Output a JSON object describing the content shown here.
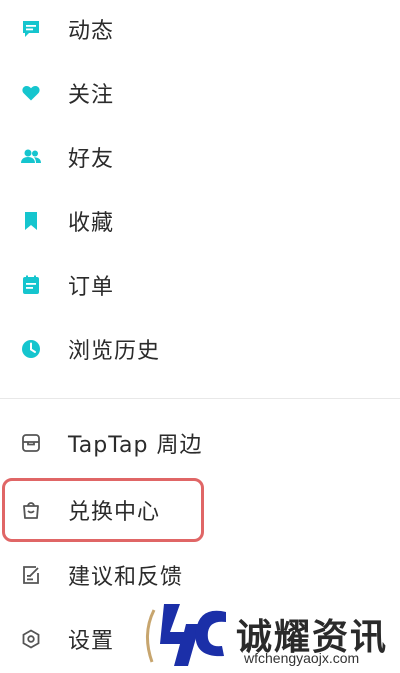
{
  "menu": {
    "items": [
      {
        "label": "动态",
        "icon": "chat-bubble-icon"
      },
      {
        "label": "关注",
        "icon": "heart-icon"
      },
      {
        "label": "好友",
        "icon": "friends-icon"
      },
      {
        "label": "收藏",
        "icon": "bookmark-icon"
      },
      {
        "label": "订单",
        "icon": "order-icon"
      },
      {
        "label": "浏览历史",
        "icon": "clock-icon"
      }
    ],
    "secondary": [
      {
        "label": "TapTap 周边",
        "icon": "merch-icon"
      },
      {
        "label": "兑换中心",
        "icon": "exchange-bag-icon"
      },
      {
        "label": "建议和反馈",
        "icon": "feedback-edit-icon"
      },
      {
        "label": "设置",
        "icon": "settings-gear-icon"
      }
    ]
  },
  "watermark": {
    "name": "诚耀资讯",
    "url": "wfchengyaojx.com"
  },
  "colors": {
    "accent": "#15c5ce",
    "icon_gray": "#555555",
    "highlight": "#e06666",
    "text": "#2b2b2b"
  }
}
